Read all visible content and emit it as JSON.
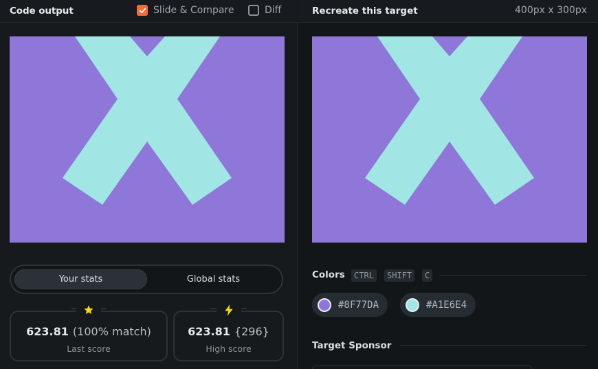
{
  "left_panel": {
    "title": "Code output",
    "slide_compare": {
      "label": "Slide & Compare",
      "checked": true
    },
    "diff": {
      "label": "Diff",
      "checked": false
    },
    "stats_tabs": {
      "active": "Your stats",
      "inactive": "Global stats"
    },
    "last_score": {
      "value": "623.81",
      "detail": "(100% match)",
      "label": "Last score",
      "icon": "star-icon"
    },
    "high_score": {
      "value": "623.81",
      "detail": "{296}",
      "label": "High score",
      "icon": "lightning-icon"
    }
  },
  "right_panel": {
    "title": "Recreate this target",
    "dimensions": "400px x 300px",
    "colors_title": "Colors",
    "shortcut_keys": [
      "CTRL",
      "SHIFT",
      "C"
    ],
    "swatches": [
      {
        "hex": "#8F77DA",
        "color": "#8F77DA"
      },
      {
        "hex": "#A1E6E4",
        "color": "#A1E6E4"
      }
    ],
    "sponsor_title": "Target Sponsor"
  },
  "target_image": {
    "background": "#8F77DA",
    "shape_color": "#A1E6E4",
    "shape": "x-cross-icon"
  },
  "theme": {
    "accent": "#F36B3B",
    "star": "#F7D51E"
  }
}
